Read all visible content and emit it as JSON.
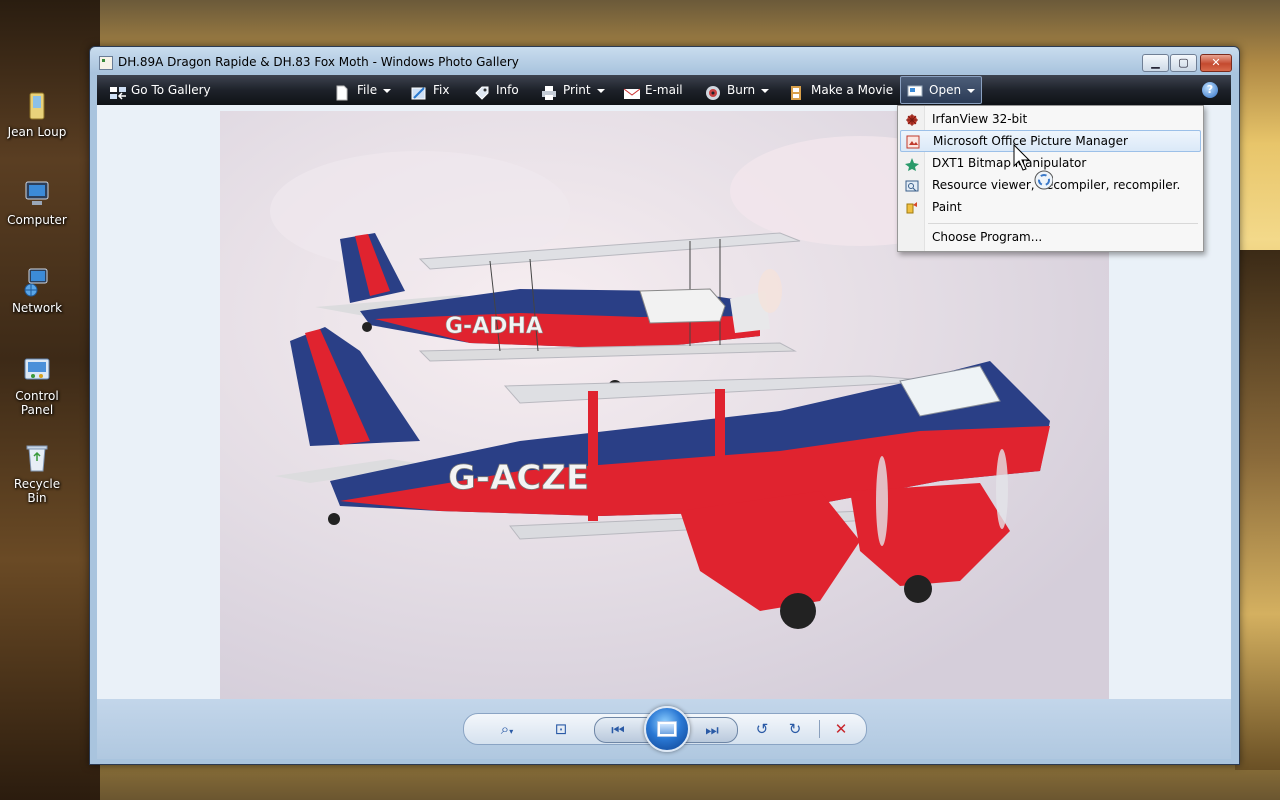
{
  "window": {
    "title": "DH.89A Dragon Rapide & DH.83 Fox Moth - Windows Photo Gallery",
    "minimize_glyph": "▁",
    "maximize_glyph": "▢",
    "close_glyph": "✕"
  },
  "desktop": {
    "icons": [
      {
        "label": "Jean Loup",
        "icon": "user-folder-icon"
      },
      {
        "label": "Computer",
        "icon": "computer-icon"
      },
      {
        "label": "Network",
        "icon": "network-icon"
      },
      {
        "label": "Control Panel",
        "icon": "control-panel-icon"
      },
      {
        "label": "Recycle Bin",
        "icon": "recycle-bin-icon"
      }
    ]
  },
  "toolbar": {
    "go_to_gallery": "Go To Gallery",
    "file": "File",
    "fix": "Fix",
    "info": "Info",
    "print": "Print",
    "email": "E-mail",
    "burn": "Burn",
    "make_movie": "Make a Movie",
    "open": "Open",
    "help": "?"
  },
  "open_menu": {
    "items": [
      {
        "label": "IrfanView 32-bit",
        "icon": "irfanview-icon"
      },
      {
        "label": "Microsoft Office Picture Manager",
        "icon": "picture-manager-icon",
        "highlighted": true
      },
      {
        "label": "DXT1 Bitmap Manipulator",
        "icon": "bitmap-manipulator-icon"
      },
      {
        "label": "Resource viewer, decompiler, recompiler.",
        "icon": "resource-viewer-icon"
      },
      {
        "label": "Paint",
        "icon": "paint-icon"
      }
    ],
    "choose_program": "Choose Program..."
  },
  "photo": {
    "registration_front": "G-ADHA",
    "registration_rear": "G-ACZE"
  },
  "controls": {
    "zoom": "⌕",
    "fit": "⊡",
    "previous": "⏮",
    "next": "⏭",
    "rotate_ccw": "↺",
    "rotate_cw": "↻",
    "delete": "✕"
  },
  "colors": {
    "toolbar_dark": "#1e222a",
    "menu_highlight": "#dbe9f8",
    "plane_red": "#e0232f",
    "plane_blue": "#2a3f86"
  }
}
